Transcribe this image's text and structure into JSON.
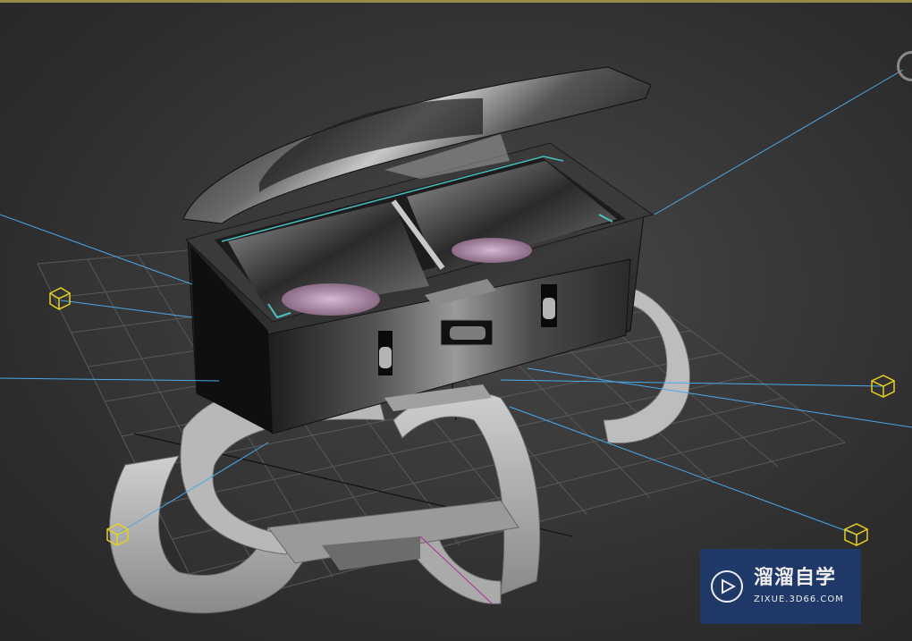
{
  "viewport": {
    "label": "3D perspective viewport",
    "scene": "open toolbox with carrying straps on ground grid",
    "background_color": "#2b2b2b",
    "grid_color": "#5a5a5a",
    "light_line_color": "#4aa8e8",
    "light_helper_color": "#e8d020"
  },
  "lights": {
    "count": 4,
    "icon": "light-cube-icon"
  },
  "watermark": {
    "brand": "溜溜自学",
    "url": "ZIXUE.3D66.COM",
    "icon": "play-icon",
    "background": "#1e3a6e"
  },
  "nav_gizmo": {
    "icon": "viewcube-ring-icon"
  }
}
